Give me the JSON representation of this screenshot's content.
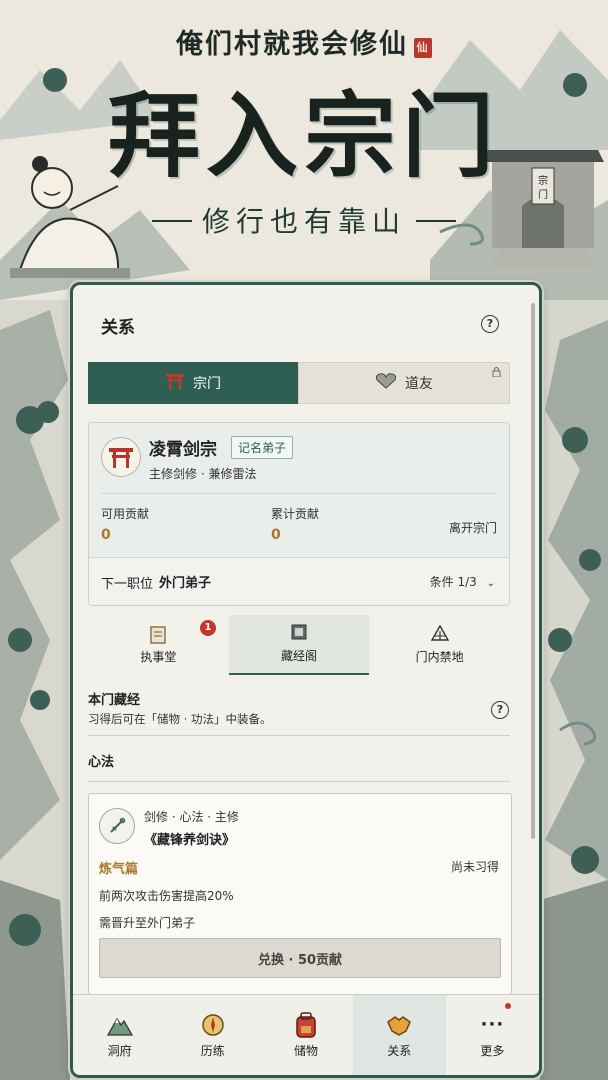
{
  "header": {
    "game_title": "俺们村就我会修仙",
    "game_seal": "仙",
    "hero_title": "拜入宗门",
    "hero_subtitle": "修行也有靠山",
    "gate_plaque": "宗门"
  },
  "panel": {
    "title": "关系",
    "help": "?",
    "tabs": [
      {
        "label": "宗门",
        "active": true,
        "icon": "torii-gate-icon"
      },
      {
        "label": "道友",
        "active": false,
        "icon": "heart-icon",
        "locked": true
      }
    ],
    "sect": {
      "name": "凌霄剑宗",
      "rank": "记名弟子",
      "description": "主修剑修 · 兼修雷法",
      "available_contribution_label": "可用贡献",
      "available_contribution": "0",
      "total_contribution_label": "累计贡献",
      "total_contribution": "0",
      "leave": "离开宗门",
      "next_position_label": "下一职位",
      "next_position": "外门弟子",
      "condition": "条件 1/3"
    },
    "subtabs": [
      {
        "label": "执事堂",
        "badge": "1",
        "icon": "scroll-icon"
      },
      {
        "label": "藏经阁",
        "active": true,
        "icon": "book-icon"
      },
      {
        "label": "门内禁地",
        "icon": "tent-icon"
      }
    ],
    "library": {
      "title": "本门藏经",
      "description": "习得后可在「储物 · 功法」中装备。",
      "section": "心法"
    },
    "technique": {
      "tags": "剑修 · 心法 · 主修",
      "name": "《藏锋养剑诀》",
      "stage": "炼气篇",
      "status": "尚未习得",
      "effect": "前两次攻击伤害提高20%",
      "requirement": "需晋升至外门弟子",
      "button": "兑换 · 50贡献"
    }
  },
  "nav": {
    "items": [
      {
        "label": "洞府",
        "icon": "mountain-icon"
      },
      {
        "label": "历练",
        "icon": "compass-icon"
      },
      {
        "label": "储物",
        "icon": "backpack-icon"
      },
      {
        "label": "关系",
        "icon": "handshake-icon",
        "active": true
      },
      {
        "label": "更多",
        "icon": "more-icon"
      }
    ]
  },
  "colors": {
    "accent": "#2f5f53",
    "gold": "#a8792d",
    "badge": "#c0392b"
  }
}
